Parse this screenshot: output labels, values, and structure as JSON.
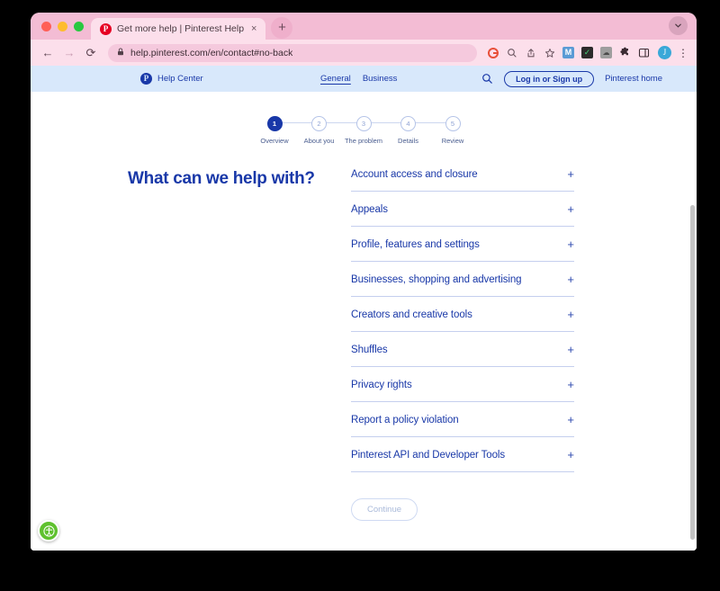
{
  "browser": {
    "tab": {
      "title": "Get more help | Pinterest Help",
      "favicon_letter": "P",
      "close_label": "×"
    },
    "new_tab_label": "+",
    "tabstrip_chevron": "⌄",
    "nav": {
      "back": "←",
      "forward": "→",
      "reload": "⟳"
    },
    "omnibox": {
      "lock_icon": "🔒",
      "url": "help.pinterest.com/en/contact#no-back"
    },
    "toolbar_icons": [
      {
        "name": "google-icon",
        "glyph": "G",
        "color": "#e8503a"
      },
      {
        "name": "search-icon",
        "glyph": "⌕",
        "color": "#5c4350"
      },
      {
        "name": "share-icon",
        "glyph": "⇧",
        "color": "#5c4350"
      },
      {
        "name": "bookmark-star-icon",
        "glyph": "☆",
        "color": "#5c4350"
      }
    ],
    "extensions": [
      {
        "name": "extension-m-icon",
        "glyph": "M",
        "bg": "#5a9bd5",
        "fg": "#ffffff"
      },
      {
        "name": "extension-checklist-icon",
        "glyph": "✓",
        "bg": "#2b2b2b",
        "fg": "#44d17a"
      },
      {
        "name": "extension-cloud-icon",
        "glyph": "●",
        "bg": "#9e9e9e",
        "fg": "#4a4a4a"
      },
      {
        "name": "extension-puzzle-icon",
        "glyph": "✦",
        "bg": "transparent",
        "fg": "#3c2c34"
      },
      {
        "name": "extension-panel-icon",
        "glyph": "▣",
        "bg": "transparent",
        "fg": "#3c2c34"
      }
    ],
    "avatar_letter": "J",
    "menu_glyph": "⋮"
  },
  "site_header": {
    "brand_mark": "P",
    "brand_text": "Help Center",
    "nav_links": [
      {
        "label": "General",
        "active": true
      },
      {
        "label": "Business",
        "active": false
      }
    ],
    "search_icon": "⌕",
    "login_label": "Log in or Sign up",
    "home_label": "Pinterest home"
  },
  "stepper": {
    "steps": [
      {
        "number": "1",
        "label": "Overview",
        "active": true
      },
      {
        "number": "2",
        "label": "About you",
        "active": false
      },
      {
        "number": "3",
        "label": "The problem",
        "active": false
      },
      {
        "number": "4",
        "label": "Details",
        "active": false
      },
      {
        "number": "5",
        "label": "Review",
        "active": false
      }
    ]
  },
  "main": {
    "page_title": "What can we help with?",
    "accordion_plus": "+",
    "topics": [
      "Account access and closure",
      "Appeals",
      "Profile, features and settings",
      "Businesses, shopping and advertising",
      "Creators and creative tools",
      "Shuffles",
      "Privacy rights",
      "Report a policy violation",
      "Pinterest API and Developer Tools"
    ],
    "continue_label": "Continue"
  },
  "accessibility_widget": {
    "name": "accessibility-widget",
    "color": "#5fc12e"
  },
  "colors": {
    "brand_blue": "#1938a8",
    "header_band": "#d8e8fb",
    "browser_chrome": "#fcdfeb",
    "tab_strip": "#f3bcd4"
  }
}
